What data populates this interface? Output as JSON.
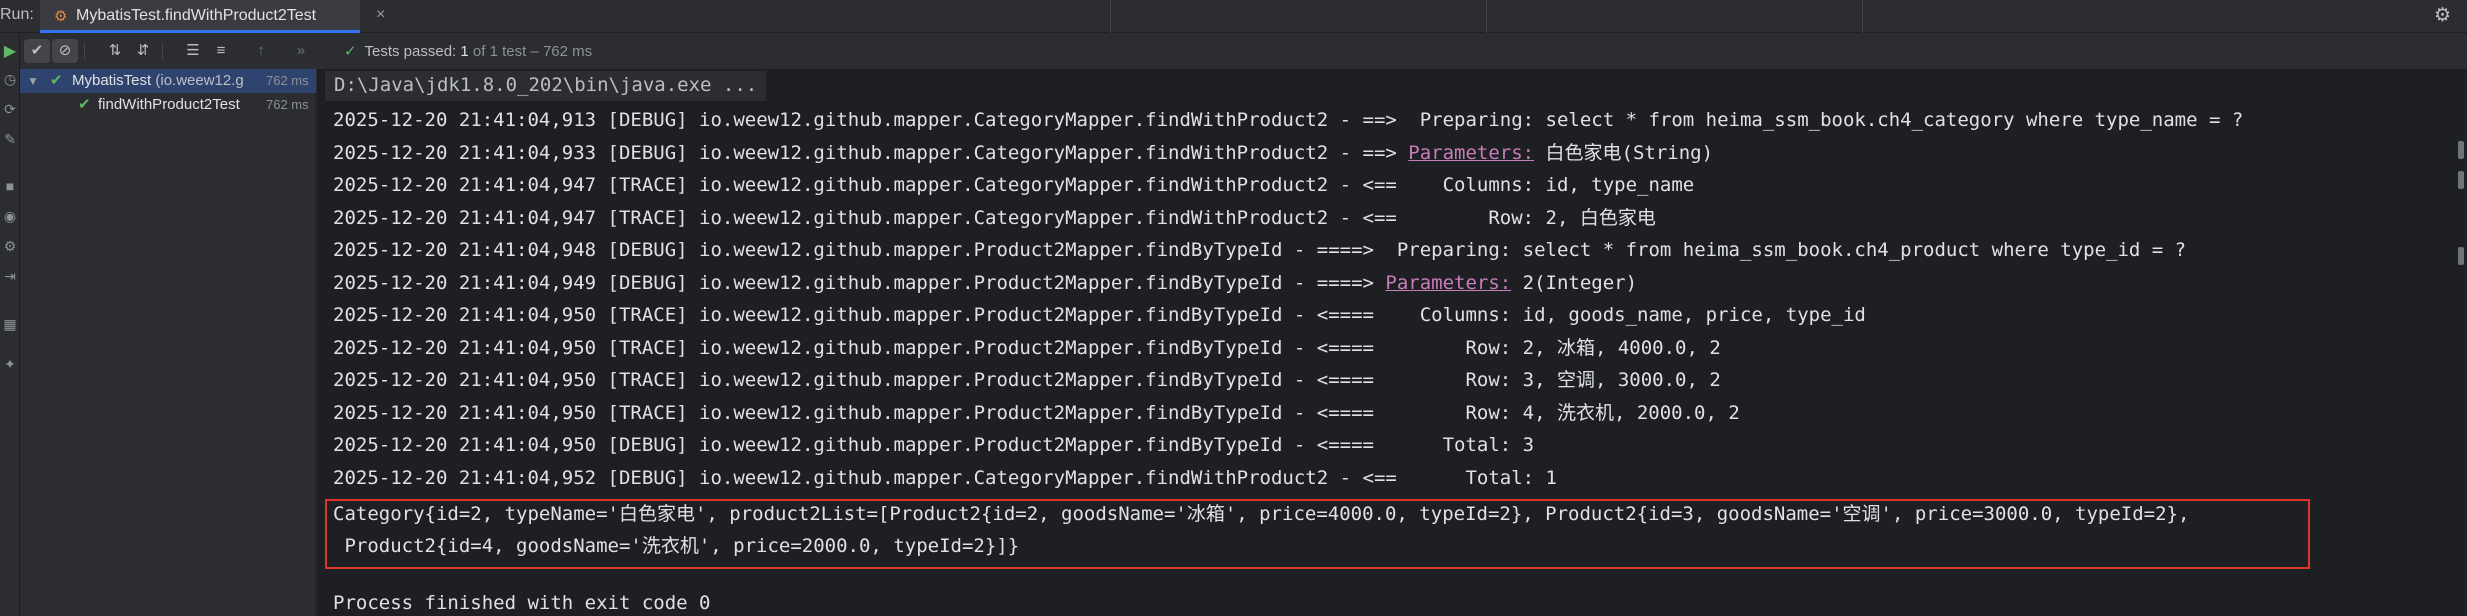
{
  "window": {
    "run_label": "Run:",
    "tab_title": "MybatisTest.findWithProduct2Test",
    "tab_icon": "test-class-icon"
  },
  "toolbar": {
    "status_prefix": "Tests passed:",
    "passed_count": "1",
    "status_suffix": "of 1 test",
    "duration": "– 762 ms"
  },
  "tree": {
    "root_name": "MybatisTest",
    "root_detail": "(io.weew12.g",
    "root_time": "762 ms",
    "child_name": "findWithProduct2Test",
    "child_time": "762 ms"
  },
  "console": {
    "command": "D:\\Java\\jdk1.8.0_202\\bin\\java.exe ...",
    "log_lines": [
      {
        "text": "2025-12-20 21:41:04,913 [DEBUG] io.weew12.github.mapper.CategoryMapper.findWithProduct2 - ==>  Preparing: select * from heima_ssm_book.ch4_category where type_name = ?",
        "link": "",
        "rest": ""
      },
      {
        "text": "2025-12-20 21:41:04,933 [DEBUG] io.weew12.github.mapper.CategoryMapper.findWithProduct2 - ==> ",
        "link": "Parameters:",
        "rest": " 白色家电(String)"
      },
      {
        "text": "2025-12-20 21:41:04,947 [TRACE] io.weew12.github.mapper.CategoryMapper.findWithProduct2 - <==    Columns: id, type_name",
        "link": "",
        "rest": ""
      },
      {
        "text": "2025-12-20 21:41:04,947 [TRACE] io.weew12.github.mapper.CategoryMapper.findWithProduct2 - <==        Row: 2, 白色家电",
        "link": "",
        "rest": ""
      },
      {
        "text": "2025-12-20 21:41:04,948 [DEBUG] io.weew12.github.mapper.Product2Mapper.findByTypeId - ====>  Preparing: select * from heima_ssm_book.ch4_product where type_id = ?",
        "link": "",
        "rest": ""
      },
      {
        "text": "2025-12-20 21:41:04,949 [DEBUG] io.weew12.github.mapper.Product2Mapper.findByTypeId - ====> ",
        "link": "Parameters:",
        "rest": " 2(Integer)"
      },
      {
        "text": "2025-12-20 21:41:04,950 [TRACE] io.weew12.github.mapper.Product2Mapper.findByTypeId - <====    Columns: id, goods_name, price, type_id",
        "link": "",
        "rest": ""
      },
      {
        "text": "2025-12-20 21:41:04,950 [TRACE] io.weew12.github.mapper.Product2Mapper.findByTypeId - <====        Row: 2, 冰箱, 4000.0, 2",
        "link": "",
        "rest": ""
      },
      {
        "text": "2025-12-20 21:41:04,950 [TRACE] io.weew12.github.mapper.Product2Mapper.findByTypeId - <====        Row: 3, 空调, 3000.0, 2",
        "link": "",
        "rest": ""
      },
      {
        "text": "2025-12-20 21:41:04,950 [TRACE] io.weew12.github.mapper.Product2Mapper.findByTypeId - <====        Row: 4, 洗衣机, 2000.0, 2",
        "link": "",
        "rest": ""
      },
      {
        "text": "2025-12-20 21:41:04,950 [DEBUG] io.weew12.github.mapper.Product2Mapper.findByTypeId - <====      Total: 3",
        "link": "",
        "rest": ""
      },
      {
        "text": "2025-12-20 21:41:04,952 [DEBUG] io.weew12.github.mapper.CategoryMapper.findWithProduct2 - <==      Total: 1",
        "link": "",
        "rest": ""
      }
    ],
    "result_line_1": "Category{id=2, typeName='白色家电', product2List=[Product2{id=2, goodsName='冰箱', price=4000.0, typeId=2}, Product2{id=3, goodsName='空调', price=3000.0, typeId=2},",
    "result_line_2": " Product2{id=4, goodsName='洗衣机', price=2000.0, typeId=2}]}",
    "exit_line": "Process finished with exit code 0"
  },
  "colors": {
    "pass_green": "#5fb865",
    "link_purple": "#c77dbb",
    "highlight_red": "#e0332c",
    "selection_blue": "#2e436e"
  }
}
